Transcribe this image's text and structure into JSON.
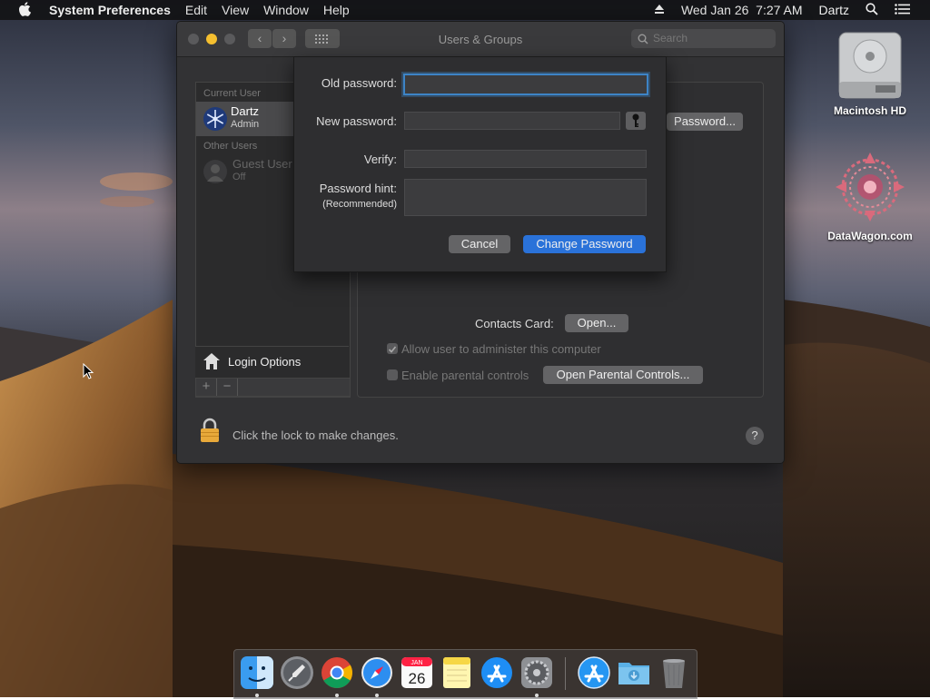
{
  "menubar": {
    "app_name": "System Preferences",
    "items": [
      "Edit",
      "View",
      "Window",
      "Help"
    ],
    "clock": "Wed Jan 26  7:27 AM",
    "user": "Dartz"
  },
  "desktop_icons": {
    "hd_label": "Macintosh HD",
    "datawagon_label": "DataWagon.com"
  },
  "window": {
    "title": "Users & Groups",
    "search_placeholder": "Search"
  },
  "sidebar": {
    "current_user_header": "Current User",
    "current_user": {
      "name": "Dartz",
      "role": "Admin"
    },
    "other_users_header": "Other Users",
    "guest_user": {
      "name": "Guest User",
      "status": "Off"
    },
    "login_options": "Login Options",
    "plus": "+",
    "minus": "−"
  },
  "main": {
    "change_password_button": "Password...",
    "contacts_card_label": "Contacts Card:",
    "open_button": "Open...",
    "allow_admin_label": "Allow user to administer this computer",
    "allow_admin_checked": true,
    "parental_controls_label": "Enable parental controls",
    "parental_controls_checked": false,
    "open_parental_button": "Open Parental Controls..."
  },
  "footer": {
    "lock_text": "Click the lock to make changes.",
    "help": "?"
  },
  "sheet": {
    "old_password_label": "Old password:",
    "new_password_label": "New password:",
    "verify_label": "Verify:",
    "hint_label": "Password hint:",
    "hint_sub_label": "(Recommended)",
    "old_password_value": "",
    "new_password_value": "",
    "verify_value": "",
    "hint_value": "",
    "cancel_button": "Cancel",
    "change_password_button": "Change Password"
  },
  "dock": {
    "calendar_day": "26",
    "calendar_month": "JAN"
  },
  "colors": {
    "accent": "#2a72d9",
    "focus_ring": "#3d84c6",
    "close": "#5a5a5c",
    "minimize": "#f5bf2f",
    "zoom": "#5a5a5c",
    "lock": "#e8a93a"
  }
}
